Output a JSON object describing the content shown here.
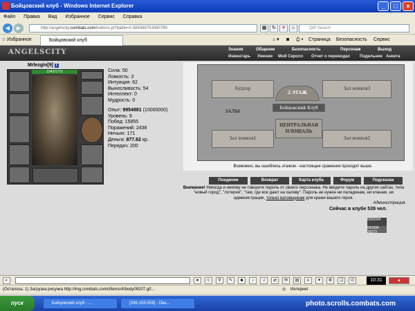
{
  "window": {
    "title": "Бойцовский клуб - Windows Internet Explorer"
  },
  "menu": [
    "Файл",
    "Правка",
    "Вид",
    "Избранное",
    "Сервис",
    "Справка"
  ],
  "address": {
    "prefix": "http://angelscity.",
    "host": "combats.com",
    "path": "/buttons.pl?battle=0.889389753090789"
  },
  "search": {
    "placeholder": "QIP Search"
  },
  "favorites": {
    "label": "Избранное",
    "tab_title": "Бойцовский клуб"
  },
  "ie_toolbar": {
    "page": "Страница",
    "security": "Безопасность",
    "service": "Сервис"
  },
  "game": {
    "logo": "ANGELSCITY",
    "nav_top": [
      "Знания",
      "Общение",
      "Безопасность",
      "Персонаж",
      "Выход"
    ],
    "nav_sub": [
      "Инвентарь",
      "Умения",
      "Мой Скролл",
      "Отчет о переводах",
      "Подельник",
      "Анкета"
    ]
  },
  "character": {
    "name": "Mrlezgin",
    "level": "[9]",
    "info_icon": "i",
    "hp": "1542/1772",
    "stats": [
      {
        "label": "Сила:",
        "value": "50"
      },
      {
        "label": "Ловкость:",
        "value": "3"
      },
      {
        "label": "Интуиция:",
        "value": "62"
      },
      {
        "label": "Выносливость:",
        "value": "54"
      },
      {
        "label": "Интеллект:",
        "value": "0"
      },
      {
        "label": "Мудрость:",
        "value": "0"
      }
    ],
    "exp_label": "Опыт:",
    "exp_value": "9954881",
    "exp_next": "(10000000)",
    "level_label": "Уровень:",
    "level_value": "9",
    "wins_label": "Побед:",
    "wins_value": "15855",
    "losses_label": "Поражений:",
    "losses_value": "2438",
    "draws_label": "Ничьих:",
    "draws_value": "171",
    "money_label": "Деньги:",
    "money_value": "877.62",
    "money_unit": "кр.",
    "transfers_label": "Передач:",
    "transfers_value": "200"
  },
  "map": {
    "rooms": {
      "boudoir": "Будуар",
      "hall3": "Зал воинов3",
      "floor2": "2 ЭТАЖ",
      "club_name": "Бойцовский Клуб",
      "halls": "ЗАЛЫ",
      "central_square": "ЦЕНТРАЛЬНАЯ ПЛОЩАДЬ",
      "hall1": "Зал воинов1",
      "hall2": "Зал воинов2"
    },
    "caption": "Возможно, вы ошиблись этажом - настоящие сражения проходят выше.",
    "buttons": [
      "Поединки",
      "Возврат",
      "Карта клуба",
      "Форум",
      "Подсказка"
    ]
  },
  "warning": {
    "bold": "Внимание!",
    "text": " Никогда и никому не говорите пароль от своего персонажа. Не вводите пароль на других сайтах, типа \"новый город\", \"лотерея\", \"там, где все дают на халяву\". Пароль не нужен ни паладинам, ни кланам, ни администрации,",
    "link": "только взломщикам",
    "tail": "для кражи вашего героя.",
    "admin": "Администрация."
  },
  "online": "Сейчас в клубе 539 чел.",
  "counters": {
    "c1": "0006044",
    "c2": "641894",
    "c3": "26373"
  },
  "clock": "10:31",
  "status": {
    "text": "(Осталось: 1) Загрузка рисунка http://img.combats.com/i/items/4/body09207.gif...",
    "zone": "Интернет"
  },
  "taskbar": {
    "start": "пуск",
    "tasks": [
      "Бойцовский клуб - ...",
      "[296-155-559] - Окн..."
    ]
  },
  "watermark": "photo.scrolls.combats.com"
}
